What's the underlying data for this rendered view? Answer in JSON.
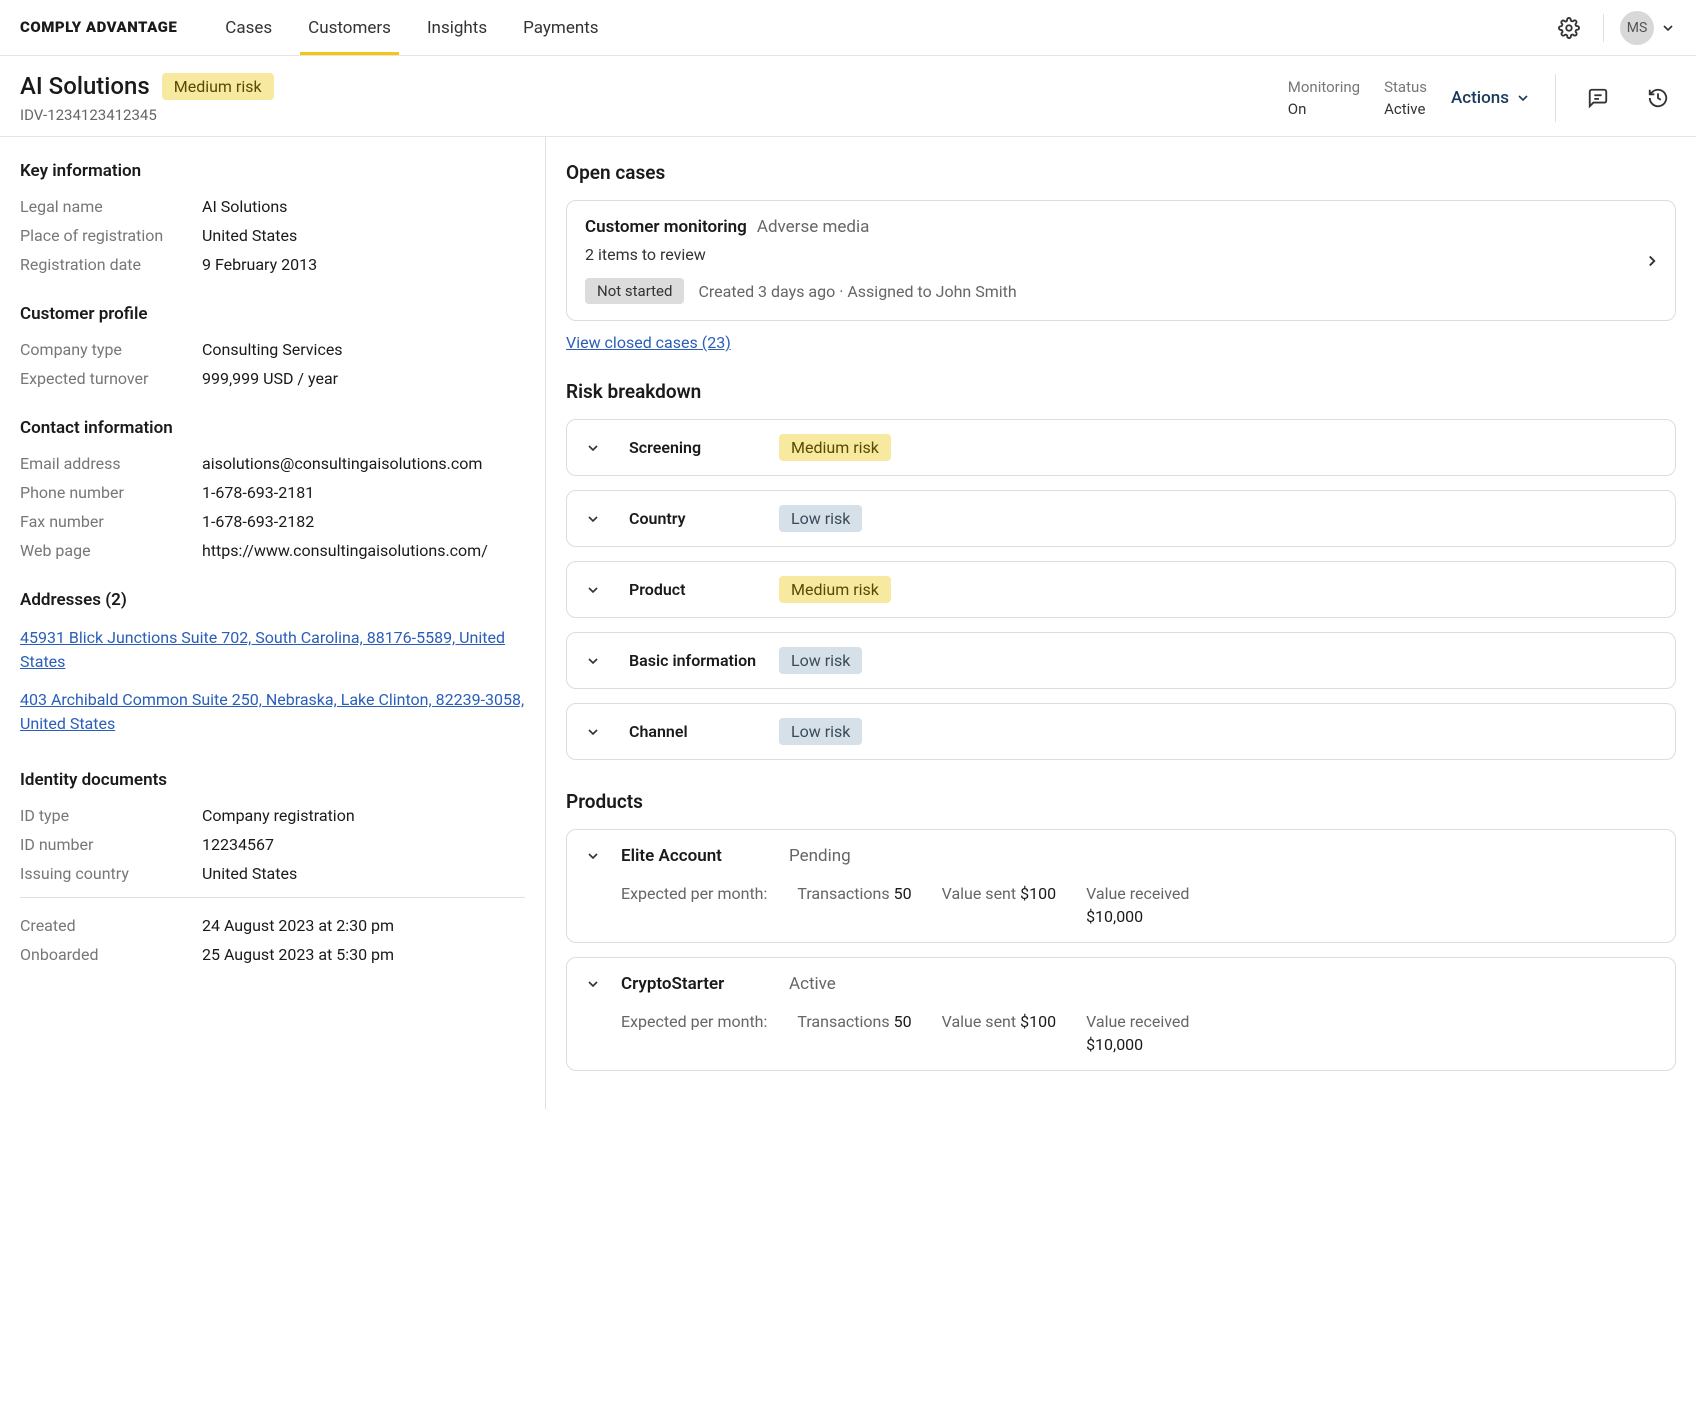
{
  "brand": "COMPLY ADVANTAGE",
  "nav": {
    "tabs": [
      "Cases",
      "Customers",
      "Insights",
      "Payments"
    ],
    "active": "Customers",
    "user_initials": "MS"
  },
  "header": {
    "title": "AI Solutions",
    "risk": "Medium risk",
    "id": "IDV-1234123412345",
    "monitoring_label": "Monitoring",
    "monitoring_value": "On",
    "status_label": "Status",
    "status_value": "Active",
    "actions": "Actions"
  },
  "key_info": {
    "title": "Key information",
    "rows": [
      {
        "label": "Legal name",
        "value": "AI Solutions"
      },
      {
        "label": "Place of registration",
        "value": "United States"
      },
      {
        "label": "Registration date",
        "value": "9 February 2013"
      }
    ]
  },
  "profile": {
    "title": "Customer profile",
    "rows": [
      {
        "label": "Company type",
        "value": "Consulting Services"
      },
      {
        "label": "Expected turnover",
        "value": "999,999 USD / year"
      }
    ]
  },
  "contact": {
    "title": "Contact information",
    "rows": [
      {
        "label": "Email address",
        "value": "aisolutions@consultingaisolutions.com"
      },
      {
        "label": "Phone number",
        "value": "1-678-693-2181"
      },
      {
        "label": "Fax number",
        "value": "1-678-693-2182"
      },
      {
        "label": "Web page",
        "value": "https://www.consultingaisolutions.com/"
      }
    ]
  },
  "addresses": {
    "title": "Addresses (2)",
    "items": [
      "45931 Blick Junctions Suite 702, South Carolina, 88176-5589, United States",
      "403 Archibald Common Suite 250, Nebraska, Lake Clinton, 82239-3058, United States"
    ]
  },
  "identity": {
    "title": "Identity documents",
    "rows": [
      {
        "label": "ID type",
        "value": "Company registration"
      },
      {
        "label": "ID number",
        "value": "12234567"
      },
      {
        "label": "Issuing country",
        "value": "United States"
      }
    ]
  },
  "timestamps": {
    "rows": [
      {
        "label": "Created",
        "value": "24 August 2023 at 2:30 pm"
      },
      {
        "label": "Onboarded",
        "value": "25 August 2023 at 5:30 pm"
      }
    ]
  },
  "open_cases": {
    "title": "Open cases",
    "card": {
      "title": "Customer monitoring",
      "subtitle": "Adverse media",
      "items_text": "2 items to review",
      "status": "Not started",
      "meta": "Created 3 days ago · Assigned to John Smith"
    },
    "closed_link": "View closed cases (23)"
  },
  "risk": {
    "title": "Risk breakdown",
    "rows": [
      {
        "label": "Screening",
        "level": "Medium risk",
        "cls": "risk-medium"
      },
      {
        "label": "Country",
        "level": "Low risk",
        "cls": "risk-low"
      },
      {
        "label": "Product",
        "level": "Medium risk",
        "cls": "risk-medium"
      },
      {
        "label": "Basic information",
        "level": "Low risk",
        "cls": "risk-low"
      },
      {
        "label": "Channel",
        "level": "Low risk",
        "cls": "risk-low"
      }
    ]
  },
  "products": {
    "title": "Products",
    "items": [
      {
        "name": "Elite Account",
        "status": "Pending",
        "expected_label": "Expected per month:",
        "tx_label": "Transactions",
        "tx_value": "50",
        "sent_label": "Value sent",
        "sent_value": "$100",
        "recv_label": "Value received",
        "recv_value": "$10,000"
      },
      {
        "name": "CryptoStarter",
        "status": "Active",
        "expected_label": "Expected per month:",
        "tx_label": "Transactions",
        "tx_value": "50",
        "sent_label": "Value sent",
        "sent_value": "$100",
        "recv_label": "Value received",
        "recv_value": "$10,000"
      }
    ]
  }
}
